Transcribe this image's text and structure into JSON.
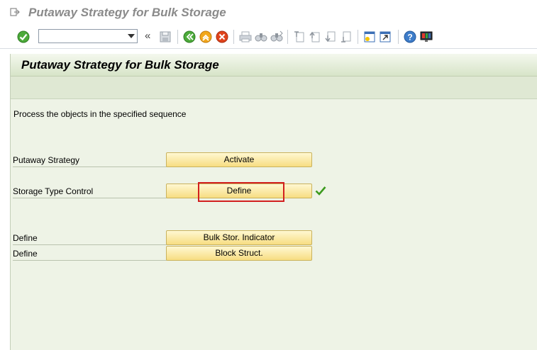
{
  "window": {
    "title": "Putaway Strategy for Bulk Storage"
  },
  "toolbar": {
    "command_field_value": "",
    "icons": [
      "enter-icon",
      "back-icon",
      "exit-icon",
      "cancel-icon",
      "save-icon",
      "print-icon",
      "find-icon",
      "find-next-icon",
      "first-page-icon",
      "previous-page-icon",
      "next-page-icon",
      "last-page-icon",
      "create-session-icon",
      "shortcut-icon",
      "help-icon",
      "customize-layout-icon"
    ]
  },
  "main": {
    "title": "Putaway Strategy for Bulk Storage",
    "instruction": "Process the objects in the specified sequence",
    "rows": [
      {
        "label": "Putaway Strategy",
        "button": "Activate"
      },
      {
        "label": "Storage Type Control",
        "button": "Define"
      },
      {
        "label": "Define",
        "button": "Bulk Stor. Indicator"
      },
      {
        "label": "Define",
        "button": "Block Struct."
      }
    ]
  },
  "colors": {
    "highlight_border": "#d21f1f",
    "button_fill": "#f7dd82",
    "background": "#eef3e6",
    "check": "#3c9a1e"
  }
}
